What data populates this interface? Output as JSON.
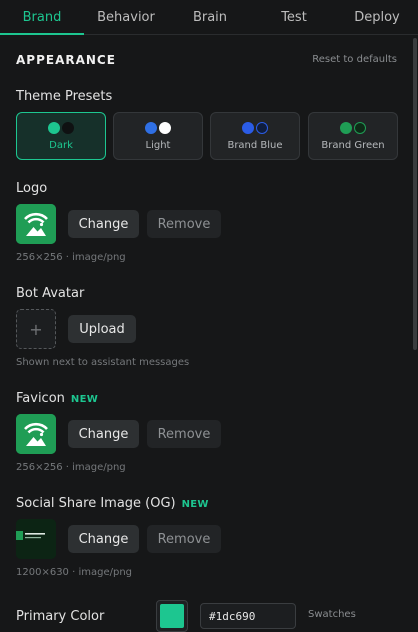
{
  "tabs": [
    {
      "label": "Brand",
      "active": true
    },
    {
      "label": "Behavior",
      "active": false
    },
    {
      "label": "Brain",
      "active": false
    },
    {
      "label": "Test",
      "active": false
    },
    {
      "label": "Deploy",
      "active": false
    }
  ],
  "appearance": {
    "title": "APPEARANCE",
    "reset_label": "Reset to defaults"
  },
  "theme_presets": {
    "label": "Theme Presets",
    "items": [
      {
        "name": "Dark",
        "colors": [
          "#1dc690",
          "#0f1112"
        ],
        "selected": true
      },
      {
        "name": "Light",
        "colors": [
          "#2f6fe4",
          "#ffffff"
        ],
        "selected": false
      },
      {
        "name": "Brand Blue",
        "colors": [
          "#2b5ce6",
          "#0f1d3d"
        ],
        "selected": false
      },
      {
        "name": "Brand Green",
        "colors": [
          "#1f9d55",
          "#0e2a17"
        ],
        "selected": false
      }
    ]
  },
  "logo": {
    "label": "Logo",
    "change_label": "Change",
    "remove_label": "Remove",
    "meta": "256×256 · image/png"
  },
  "bot_avatar": {
    "label": "Bot Avatar",
    "placeholder_icon": "+",
    "upload_label": "Upload",
    "hint": "Shown next to assistant messages"
  },
  "favicon": {
    "label": "Favicon",
    "badge": "NEW",
    "change_label": "Change",
    "remove_label": "Remove",
    "meta": "256×256 · image/png"
  },
  "og_image": {
    "label": "Social Share Image (OG)",
    "badge": "NEW",
    "change_label": "Change",
    "remove_label": "Remove",
    "meta": "1200×630 · image/png"
  },
  "primary_color": {
    "label": "Primary Color",
    "value": "#1dc690",
    "swatches_label": "Swatches"
  },
  "colors": {
    "accent": "#1dc690",
    "background": "#161718",
    "logo_green": "#1f9d55"
  }
}
